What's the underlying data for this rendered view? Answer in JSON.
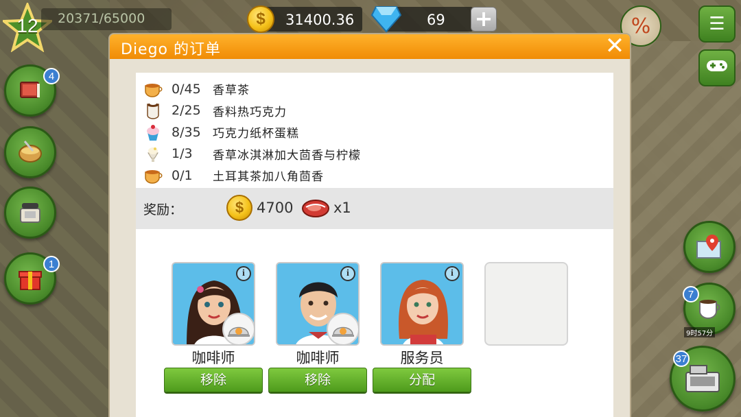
{
  "hud": {
    "level": "12",
    "xp": "20371/65000",
    "coins": "31400.36",
    "gems": "69",
    "add_label": "+"
  },
  "side": {
    "recipe_badge": "4",
    "gift_badge": "1",
    "cafe_badge": "7",
    "register_badge": "37",
    "cafe_timer": "9时57分"
  },
  "dialog": {
    "title": "Diego 的订单",
    "close_label": "✕",
    "orders": [
      {
        "count": "0/45",
        "name": "香草茶",
        "icon": "tea-cup-icon"
      },
      {
        "count": "2/25",
        "name": "香料热巧克力",
        "icon": "hot-chocolate-icon"
      },
      {
        "count": "8/35",
        "name": "巧克力纸杯蛋糕",
        "icon": "cupcake-icon"
      },
      {
        "count": "1/3",
        "name": "香草冰淇淋加大茴香与柠檬",
        "icon": "ice-cream-icon"
      },
      {
        "count": "0/1",
        "name": "土耳其茶加八角茴香",
        "icon": "tea-cup-icon"
      }
    ],
    "reward": {
      "label": "奖励：",
      "coins": "4700",
      "item": "x1"
    },
    "staff": [
      {
        "role": "咖啡师",
        "button": "移除"
      },
      {
        "role": "咖啡师",
        "button": "移除"
      },
      {
        "role": "服务员",
        "button": "分配"
      }
    ]
  },
  "colors": {
    "header": "#f59a0f",
    "button_green": "#5fae27",
    "panel": "#ffffff",
    "reward_band": "#e5e5e5"
  }
}
